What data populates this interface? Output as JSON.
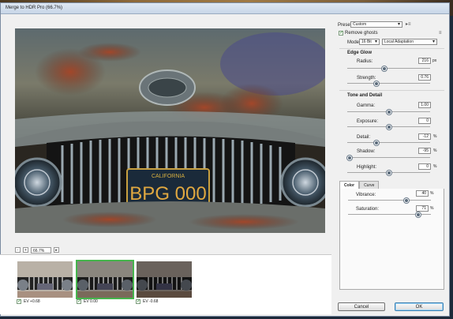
{
  "window": {
    "title": "Merge to HDR Pro (66.7%)"
  },
  "preview": {
    "plate_top": "CALIFORNIA",
    "plate_number": "BPG 000",
    "zoom_value": "66.7%"
  },
  "thumbnails": [
    {
      "label": "EV +0.68",
      "checked": true,
      "selected": false
    },
    {
      "label": "EV 0.00",
      "checked": true,
      "selected": true
    },
    {
      "label": "EV -0.68",
      "checked": true,
      "selected": false
    }
  ],
  "panel": {
    "preset_label": "Preset:",
    "preset_value": "Custom",
    "remove_ghosts_label": "Remove ghosts",
    "mode_label": "Mode:",
    "mode_bits": "16 Bit",
    "mode_method": "Local Adaptation",
    "edge_glow": {
      "title": "Edge Glow",
      "radius": {
        "label": "Radius:",
        "value": "216",
        "unit": "px",
        "level": 0.45
      },
      "strength": {
        "label": "Strength:",
        "value": "0.76",
        "unit": "",
        "level": 0.35
      }
    },
    "tone_detail": {
      "title": "Tone and Detail",
      "gamma": {
        "label": "Gamma:",
        "value": "1.00",
        "unit": "",
        "level": 0.5
      },
      "exposure": {
        "label": "Exposure:",
        "value": "0",
        "unit": "",
        "level": 0.5
      },
      "detail": {
        "label": "Detail:",
        "value": "-12",
        "unit": "%",
        "level": 0.35
      },
      "shadow": {
        "label": "Shadow:",
        "value": "-95",
        "unit": "%",
        "level": 0.03
      },
      "highlight": {
        "label": "Highlight:",
        "value": "0",
        "unit": "%",
        "level": 0.5
      }
    },
    "tabs": [
      "Color",
      "Curve"
    ],
    "color": {
      "vibrance": {
        "label": "Vibrance:",
        "value": "40",
        "unit": "%",
        "level": 0.7
      },
      "saturation": {
        "label": "Saturation:",
        "value": "71",
        "unit": "%",
        "level": 0.85
      }
    }
  },
  "buttons": {
    "cancel": "Cancel",
    "ok": "OK"
  }
}
